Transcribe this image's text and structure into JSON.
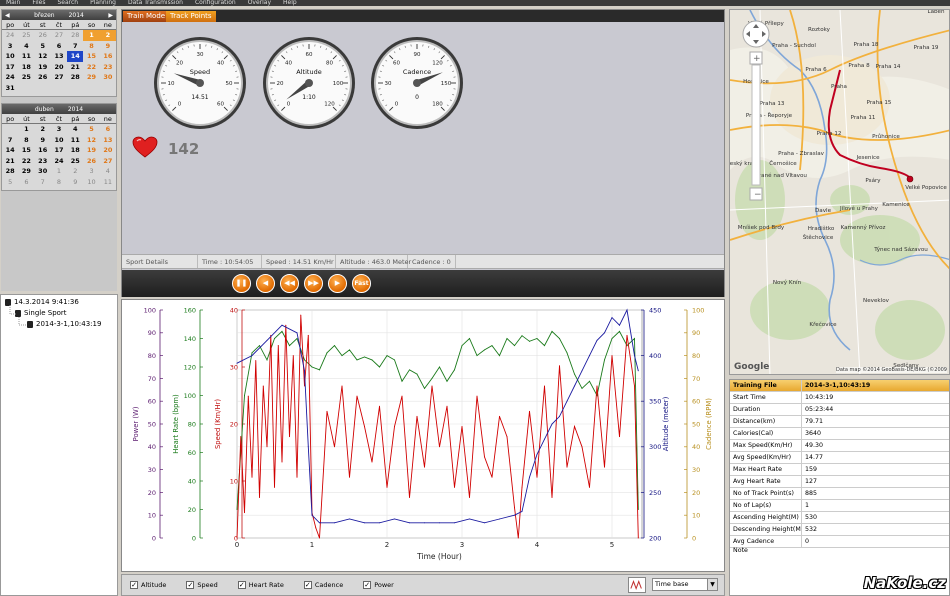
{
  "menu": [
    "Main",
    "Files",
    "Search",
    "Planning",
    "Data Transmission",
    "Configuration",
    "Overlay",
    "Help"
  ],
  "calendar1": {
    "month": "březen",
    "year": "2014",
    "dow": [
      "po",
      "út",
      "st",
      "čt",
      "pá",
      "so",
      "ne"
    ],
    "weeks": [
      [
        [
          "24",
          1
        ],
        [
          "25",
          1
        ],
        [
          "26",
          1
        ],
        [
          "27",
          1
        ],
        [
          "28",
          1
        ],
        [
          "1",
          2
        ],
        [
          "2",
          3
        ]
      ],
      [
        [
          "3",
          0
        ],
        [
          "4",
          0
        ],
        [
          "5",
          0
        ],
        [
          "6",
          0
        ],
        [
          "7",
          0
        ],
        [
          "8",
          5
        ],
        [
          "9",
          5
        ]
      ],
      [
        [
          "10",
          0
        ],
        [
          "11",
          0
        ],
        [
          "12",
          0
        ],
        [
          "13",
          0
        ],
        [
          "14",
          4
        ],
        [
          "15",
          5
        ],
        [
          "16",
          5
        ]
      ],
      [
        [
          "17",
          0
        ],
        [
          "18",
          0
        ],
        [
          "19",
          0
        ],
        [
          "20",
          0
        ],
        [
          "21",
          0
        ],
        [
          "22",
          5
        ],
        [
          "23",
          5
        ]
      ],
      [
        [
          "24",
          0
        ],
        [
          "25",
          0
        ],
        [
          "26",
          0
        ],
        [
          "27",
          0
        ],
        [
          "28",
          0
        ],
        [
          "29",
          5
        ],
        [
          "30",
          5
        ]
      ],
      [
        [
          "31",
          0
        ]
      ]
    ]
  },
  "calendar2": {
    "month": "duben",
    "year": "2014",
    "dow": [
      "po",
      "út",
      "st",
      "čt",
      "pá",
      "so",
      "ne"
    ],
    "weeks": [
      [
        [
          "",
          0
        ],
        [
          "1",
          0
        ],
        [
          "2",
          0
        ],
        [
          "3",
          0
        ],
        [
          "4",
          0
        ],
        [
          "5",
          5
        ],
        [
          "6",
          5
        ]
      ],
      [
        [
          "7",
          0
        ],
        [
          "8",
          0
        ],
        [
          "9",
          0
        ],
        [
          "10",
          0
        ],
        [
          "11",
          0
        ],
        [
          "12",
          5
        ],
        [
          "13",
          5
        ]
      ],
      [
        [
          "14",
          0
        ],
        [
          "15",
          0
        ],
        [
          "16",
          0
        ],
        [
          "17",
          0
        ],
        [
          "18",
          0
        ],
        [
          "19",
          5
        ],
        [
          "20",
          5
        ]
      ],
      [
        [
          "21",
          0
        ],
        [
          "22",
          0
        ],
        [
          "23",
          0
        ],
        [
          "24",
          0
        ],
        [
          "25",
          0
        ],
        [
          "26",
          5
        ],
        [
          "27",
          5
        ]
      ],
      [
        [
          "28",
          0
        ],
        [
          "29",
          0
        ],
        [
          "30",
          0
        ],
        [
          "1",
          1
        ],
        [
          "2",
          1
        ],
        [
          "3",
          1
        ],
        [
          "4",
          1
        ]
      ],
      [
        [
          "5",
          1
        ],
        [
          "6",
          1
        ],
        [
          "7",
          1
        ],
        [
          "8",
          1
        ],
        [
          "9",
          1
        ],
        [
          "10",
          1
        ],
        [
          "11",
          1
        ]
      ]
    ]
  },
  "tree": {
    "root": "14.3.2014 9:41:36",
    "sport": "Single Sport",
    "file": "2014-3-1,10:43:19"
  },
  "tabs": {
    "active": "Train Mode",
    "inactive": "Track Points"
  },
  "gauges": [
    {
      "label": "Speed",
      "value": "14.51",
      "ticks": [
        "0",
        "10",
        "20",
        "30",
        "40",
        "50",
        "60"
      ],
      "max": 60,
      "v": 14.51
    },
    {
      "label": "Altitude",
      "value": "1:10",
      "ticks": [
        "0",
        "20",
        "40",
        "60",
        "80",
        "100",
        "120"
      ],
      "max": 120,
      "v": 4
    },
    {
      "label": "Cadence",
      "value": "0",
      "ticks": [
        "0",
        "30",
        "60",
        "90",
        "120",
        "150",
        "180"
      ],
      "max": 180,
      "v": 135
    }
  ],
  "heart_rate": "142",
  "details": {
    "title": "Sport Details",
    "time": "Time : 10:54:05",
    "speed": "Speed : 14.51 Km/Hr",
    "altitude": "Altitude : 463.0 Meter",
    "cadence": "Cadence : 0"
  },
  "controls": {
    "fast": "Fast"
  },
  "chart_data": {
    "type": "line",
    "xlabel": "Time (Hour)",
    "xlim": [
      0,
      5.4
    ],
    "xticks": [
      "0",
      "1",
      "2",
      "3",
      "4",
      "5"
    ],
    "axes": [
      {
        "label": "Power (W)",
        "ticks": [
          "0",
          "10",
          "20",
          "30",
          "40",
          "50",
          "60",
          "70",
          "80",
          "90",
          "100"
        ],
        "color": "#5a1a6e"
      },
      {
        "label": "Heart Rate (bpm)",
        "ticks": [
          "0",
          "20",
          "40",
          "60",
          "80",
          "100",
          "120",
          "140",
          "160"
        ],
        "color": "#1a7a1a"
      },
      {
        "label": "Speed (Km/Hr)",
        "ticks": [
          "0",
          "10",
          "20",
          "30",
          "40"
        ],
        "color": "#c01010"
      },
      {
        "label": "Altitude (meter)",
        "ticks": [
          "200",
          "250",
          "300",
          "350",
          "400",
          "450"
        ],
        "color": "#101080"
      },
      {
        "label": "Cadence (RPM)",
        "ticks": [
          "0",
          "10",
          "20",
          "30",
          "40",
          "50",
          "60",
          "70",
          "80",
          "90",
          "100"
        ],
        "color": "#b89020"
      }
    ],
    "series": [
      {
        "axis": "Heart Rate (bpm)",
        "color": "#1a7a1a",
        "x": [
          0,
          0.1,
          0.2,
          0.3,
          0.4,
          0.5,
          0.6,
          0.7,
          0.8,
          0.9,
          1.0,
          1.1,
          1.2,
          1.3,
          1.4,
          1.5,
          1.6,
          1.7,
          1.8,
          1.9,
          2.0,
          2.1,
          2.2,
          2.3,
          2.4,
          2.5,
          2.6,
          2.7,
          2.8,
          2.9,
          3.0,
          3.1,
          3.2,
          3.3,
          3.4,
          3.5,
          3.6,
          3.7,
          3.8,
          3.9,
          4.0,
          4.1,
          4.2,
          4.3,
          4.4,
          4.5,
          4.6,
          4.7,
          4.8,
          4.9,
          5.0,
          5.1,
          5.2,
          5.3,
          5.35
        ],
        "y": [
          20,
          100,
          130,
          135,
          125,
          140,
          145,
          135,
          140,
          125,
          120,
          118,
          130,
          135,
          128,
          132,
          125,
          127,
          125,
          120,
          128,
          125,
          110,
          118,
          115,
          105,
          112,
          120,
          110,
          118,
          135,
          140,
          128,
          132,
          135,
          128,
          140,
          135,
          142,
          138,
          140,
          135,
          145,
          140,
          130,
          115,
          105,
          110,
          100,
          125,
          140,
          145,
          135,
          140,
          20
        ]
      },
      {
        "axis": "Speed (Km/Hr)",
        "color": "#d00000",
        "x": [
          0,
          0.05,
          0.1,
          0.15,
          0.2,
          0.25,
          0.3,
          0.35,
          0.4,
          0.45,
          0.5,
          0.55,
          0.6,
          0.65,
          0.7,
          0.75,
          0.8,
          0.85,
          0.9,
          0.95,
          1.0,
          1.05,
          1.1,
          1.2,
          1.3,
          1.4,
          1.5,
          1.6,
          1.7,
          1.8,
          1.9,
          2.0,
          2.1,
          2.2,
          2.3,
          2.4,
          2.5,
          2.6,
          2.7,
          2.8,
          2.9,
          3.0,
          3.1,
          3.2,
          3.3,
          3.4,
          3.5,
          3.6,
          3.7,
          3.75,
          3.8,
          3.9,
          4.0,
          4.1,
          4.2,
          4.3,
          4.4,
          4.5,
          4.6,
          4.7,
          4.8,
          4.9,
          5.0,
          5.1,
          5.2,
          5.3,
          5.35
        ],
        "y": [
          0,
          20,
          5,
          28,
          12,
          35,
          8,
          30,
          18,
          40,
          10,
          38,
          15,
          42,
          20,
          36,
          12,
          44,
          30,
          40,
          5,
          2,
          0,
          25,
          18,
          30,
          12,
          28,
          22,
          15,
          26,
          10,
          22,
          28,
          8,
          24,
          14,
          30,
          18,
          26,
          10,
          22,
          8,
          28,
          16,
          12,
          24,
          20,
          6,
          0,
          10,
          25,
          12,
          30,
          8,
          34,
          14,
          22,
          18,
          10,
          30,
          14,
          36,
          20,
          40,
          30,
          0
        ]
      },
      {
        "axis": "Altitude (meter)",
        "color": "#1a1aa0",
        "x": [
          0,
          0.2,
          0.4,
          0.6,
          0.8,
          0.9,
          0.95,
          1.0,
          1.1,
          1.3,
          1.5,
          1.7,
          1.9,
          2.1,
          2.3,
          2.5,
          2.7,
          2.9,
          3.1,
          3.3,
          3.5,
          3.7,
          3.8,
          3.9,
          4.0,
          4.1,
          4.2,
          4.3,
          4.4,
          4.5,
          4.6,
          4.7,
          4.8,
          4.9,
          5.0,
          5.1,
          5.2,
          5.3,
          5.35
        ],
        "y": [
          410,
          420,
          440,
          460,
          450,
          400,
          300,
          210,
          200,
          200,
          205,
          200,
          200,
          205,
          200,
          200,
          200,
          200,
          205,
          200,
          205,
          210,
          215,
          260,
          290,
          310,
          330,
          340,
          360,
          380,
          400,
          420,
          440,
          450,
          470,
          460,
          480,
          420,
          400
        ]
      }
    ]
  },
  "chart_options": [
    "Altitude",
    "Speed",
    "Heart Rate",
    "Cadence",
    "Power"
  ],
  "timebase": "Time base",
  "map": {
    "labels": [
      [
        "Velké Přílepy",
        765,
        24
      ],
      [
        "Roztoky",
        818,
        30
      ],
      [
        "Laben",
        935,
        12
      ],
      [
        "Praha 18",
        865,
        45
      ],
      [
        "Praha - Suchdol",
        793,
        46
      ],
      [
        "Praha 19",
        925,
        48
      ],
      [
        "Praha 6",
        815,
        70
      ],
      [
        "Praha 8",
        858,
        66
      ],
      [
        "Praha 14",
        887,
        67
      ],
      [
        "Hostivice",
        755,
        82
      ],
      [
        "Praha",
        838,
        87
      ],
      [
        "Praha 13",
        771,
        104
      ],
      [
        "Praha 15",
        878,
        103
      ],
      [
        "Praha - Řeporyje",
        768,
        116
      ],
      [
        "Praha 11",
        862,
        118
      ],
      [
        "Praha 12",
        828,
        134
      ],
      [
        "Průhonice",
        885,
        137
      ],
      [
        "Praha - Zbraslav",
        800,
        154
      ],
      [
        "Jesenice",
        867,
        158
      ],
      [
        "Černošice",
        782,
        164
      ],
      [
        "Český kras",
        740,
        164
      ],
      [
        "Psáry",
        872,
        181
      ],
      [
        "Vrané nad Vltavou",
        780,
        176
      ],
      [
        "Velké Popovice",
        925,
        188
      ],
      [
        "Davle",
        822,
        211
      ],
      [
        "Jílové u Prahy",
        858,
        209
      ],
      [
        "Kamenice",
        895,
        205
      ],
      [
        "Hradištko",
        820,
        229
      ],
      [
        "Mníšek pod Brdy",
        760,
        228
      ],
      [
        "Kamenný Přívoz",
        862,
        228
      ],
      [
        "Štěchovice",
        817,
        238
      ],
      [
        "Týnec nad Sázavou",
        900,
        250
      ],
      [
        "Nový Knín",
        786,
        283
      ],
      [
        "Neveklov",
        875,
        301
      ],
      [
        "Křečovice",
        822,
        325
      ],
      [
        "Sedlčany",
        905,
        366
      ]
    ],
    "attribution": "Data map ©2014 GeoBasis-DE/BKG (©2009",
    "logo": "Google"
  },
  "info": {
    "header": [
      "Training File",
      "2014-3-1,10:43:19"
    ],
    "rows": [
      [
        "Start Time",
        "10:43:19"
      ],
      [
        "Duration",
        "05:23:44"
      ],
      [
        "Distance(km)",
        "79.71"
      ],
      [
        "Calories(Cal)",
        "3640"
      ],
      [
        "Max Speed(Km/Hr)",
        "49.30"
      ],
      [
        "Avg Speed(Km/Hr)",
        "14.77"
      ],
      [
        "Max Heart Rate",
        "159"
      ],
      [
        "Avg Heart Rate",
        "127"
      ],
      [
        "No of Track Point(s)",
        "885"
      ],
      [
        "No of Lap(s)",
        "1"
      ],
      [
        "Ascending Height(M)",
        "530"
      ],
      [
        "Descending Height(M)",
        "532"
      ],
      [
        "Avg Cadence",
        "0"
      ]
    ],
    "note": "Note"
  },
  "watermark": "NaKole.cz"
}
